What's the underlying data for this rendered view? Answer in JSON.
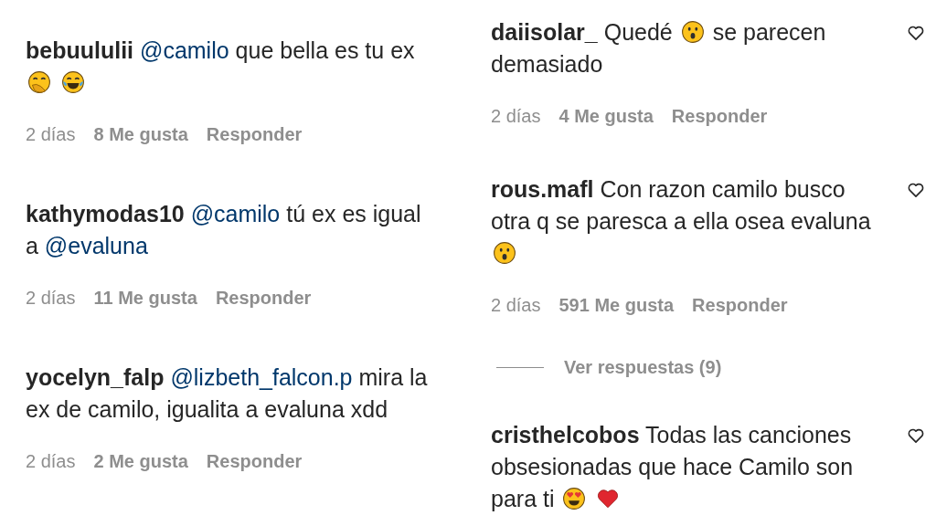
{
  "columns": [
    {
      "comments": [
        {
          "username": "bebuululii",
          "like_icon": false,
          "parts": [
            {
              "kind": "mention",
              "text": "@camilo"
            },
            {
              "kind": "text",
              "text": "que bella es tu ex"
            },
            {
              "kind": "grinhand"
            },
            {
              "kind": "joy"
            }
          ],
          "time": "2 días",
          "likes": "8 Me gusta",
          "reply": "Responder"
        },
        {
          "username": "kathymodas10",
          "like_icon": false,
          "parts": [
            {
              "kind": "mention",
              "text": "@camilo"
            },
            {
              "kind": "text",
              "text": "tú ex es igual a"
            },
            {
              "kind": "mention",
              "text": "@evaluna"
            }
          ],
          "time": "2 días",
          "likes": "11 Me gusta",
          "reply": "Responder"
        },
        {
          "username": "yocelyn_falp",
          "like_icon": false,
          "parts": [
            {
              "kind": "mention",
              "text": "@lizbeth_falcon.p"
            },
            {
              "kind": "text",
              "text": "mira la ex de camilo, igualita a evaluna xdd"
            }
          ],
          "time": "2 días",
          "likes": "2 Me gusta",
          "reply": "Responder"
        }
      ]
    },
    {
      "comments": [
        {
          "username": "daiisolar_",
          "like_icon": true,
          "parts": [
            {
              "kind": "text",
              "text": "Quedé"
            },
            {
              "kind": "astonished"
            },
            {
              "kind": "text",
              "text": "se parecen demasiado"
            }
          ],
          "time": "2 días",
          "likes": "4 Me gusta",
          "reply": "Responder"
        },
        {
          "username": "rous.mafl",
          "like_icon": true,
          "parts": [
            {
              "kind": "text",
              "text": "Con razon camilo busco otra q se paresca a ella osea evaluna"
            },
            {
              "kind": "astonished"
            }
          ],
          "time": "2 días",
          "likes": "591 Me gusta",
          "reply": "Responder",
          "view_replies": "Ver respuestas (9)"
        },
        {
          "username": "cristhelcobos",
          "like_icon": true,
          "parts": [
            {
              "kind": "text",
              "text": "Todas las canciones obsesionadas que hace Camilo son para ti"
            },
            {
              "kind": "hearteyes"
            },
            {
              "kind": "heart"
            }
          ]
        }
      ]
    }
  ]
}
